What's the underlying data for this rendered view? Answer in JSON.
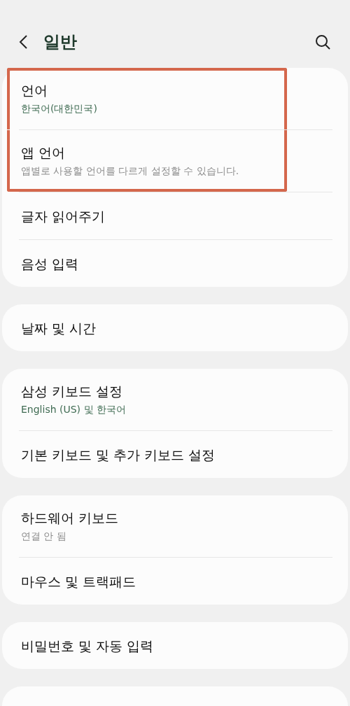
{
  "header": {
    "title": "일반"
  },
  "groups": [
    {
      "items": [
        {
          "title": "언어",
          "subtitle": {
            "text": "한국어(대한민국)",
            "kind": "value"
          },
          "highlighted": true
        },
        {
          "title": "앱 언어",
          "subtitle": {
            "text": "앱별로 사용할 언어를 다르게 설정할 수 있습니다.",
            "kind": "hint"
          },
          "highlighted": true
        },
        {
          "title": "글자 읽어주기",
          "highlighted": false
        },
        {
          "title": "음성 입력",
          "highlighted": false
        }
      ]
    },
    {
      "items": [
        {
          "title": "날짜 및 시간",
          "highlighted": false
        }
      ]
    },
    {
      "items": [
        {
          "title": "삼성 키보드 설정",
          "subtitle": {
            "text": "English (US) 및 한국어",
            "kind": "value"
          },
          "highlighted": false
        },
        {
          "title": "기본 키보드 및 추가 키보드 설정",
          "highlighted": false
        }
      ]
    },
    {
      "items": [
        {
          "title": "하드웨어 키보드",
          "subtitle": {
            "text": "연결 안 됨",
            "kind": "hint"
          },
          "highlighted": false
        },
        {
          "title": "마우스 및 트랙패드",
          "highlighted": false
        }
      ]
    },
    {
      "items": [
        {
          "title": "비밀번호 및 자동 입력",
          "highlighted": false
        }
      ]
    }
  ]
}
